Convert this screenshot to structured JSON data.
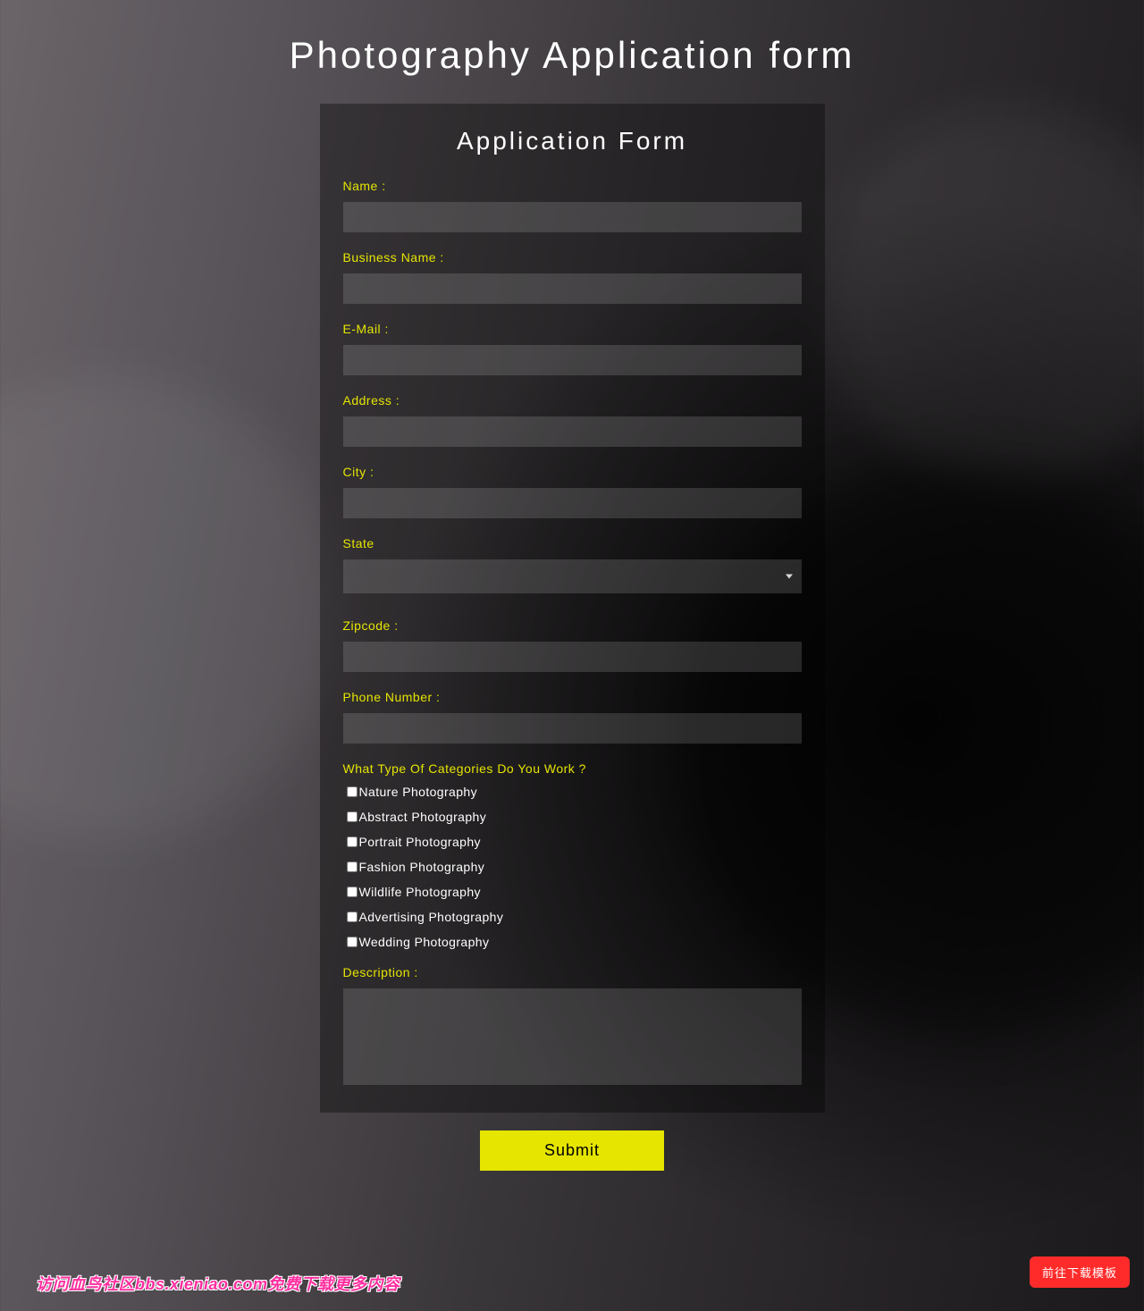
{
  "page": {
    "title": "Photography Application form"
  },
  "form": {
    "heading": "Application Form",
    "labels": {
      "name": "Name :",
      "business": "Business Name :",
      "email": "E-Mail :",
      "address": "Address :",
      "city": "City :",
      "state": "State",
      "zipcode": "Zipcode :",
      "phone": "Phone Number :",
      "categories": "What Type Of Categories Do You Work ?",
      "description": "Description :"
    },
    "values": {
      "name": "",
      "business": "",
      "email": "",
      "address": "",
      "city": "",
      "state": "",
      "zipcode": "",
      "phone": "",
      "description": ""
    },
    "categories": [
      "Nature Photography",
      "Abstract Photography",
      "Portrait Photography",
      "Fashion Photography",
      "Wildlife Photography",
      "Advertising Photography",
      "Wedding Photography"
    ],
    "submit": "Submit"
  },
  "overlay": {
    "download": "前往下载模板",
    "watermark": "访问血鸟社区bbs.xieniao.com免费下载更多内容"
  }
}
